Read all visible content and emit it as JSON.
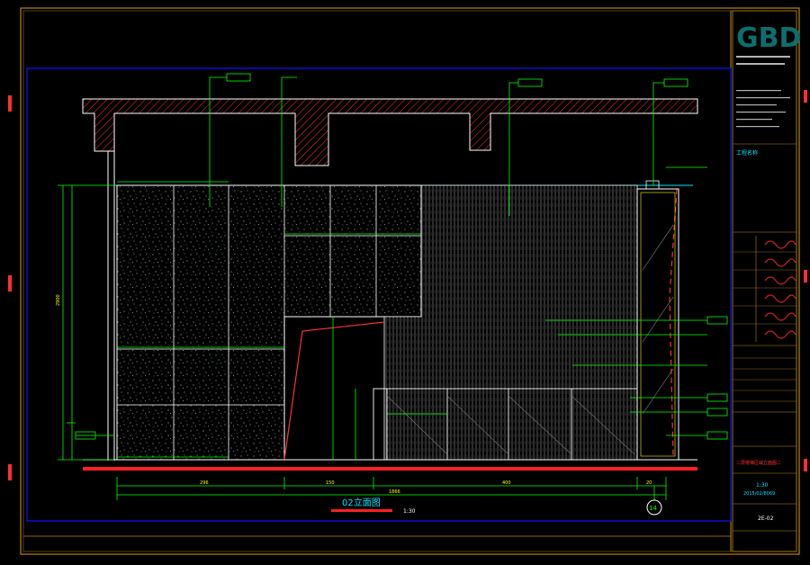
{
  "drawing": {
    "view_title": "02立面图",
    "scale_label": "1:30",
    "axis_marker": "14",
    "dimensions_bottom": [
      "296",
      "150",
      "400",
      "20"
    ],
    "dimension_total": "1866",
    "dimension_left_total": "2900"
  },
  "title_block": {
    "logo": "GBD",
    "project_name_label": "工程名称",
    "scale_value": "1:30",
    "date_value": "2015/02/8069",
    "sheet_no": "2E-02",
    "drawing_name": "二层楼梯区域立面图二"
  },
  "colors": {
    "frame": "#b8860b",
    "viewport": "#1010ff",
    "lines": "#ffffff",
    "dims": "#00ff00",
    "hatch": "#ff3030",
    "cyan": "#00e5ff",
    "yellow": "#ffff00",
    "logo": "#0e6e6e"
  }
}
